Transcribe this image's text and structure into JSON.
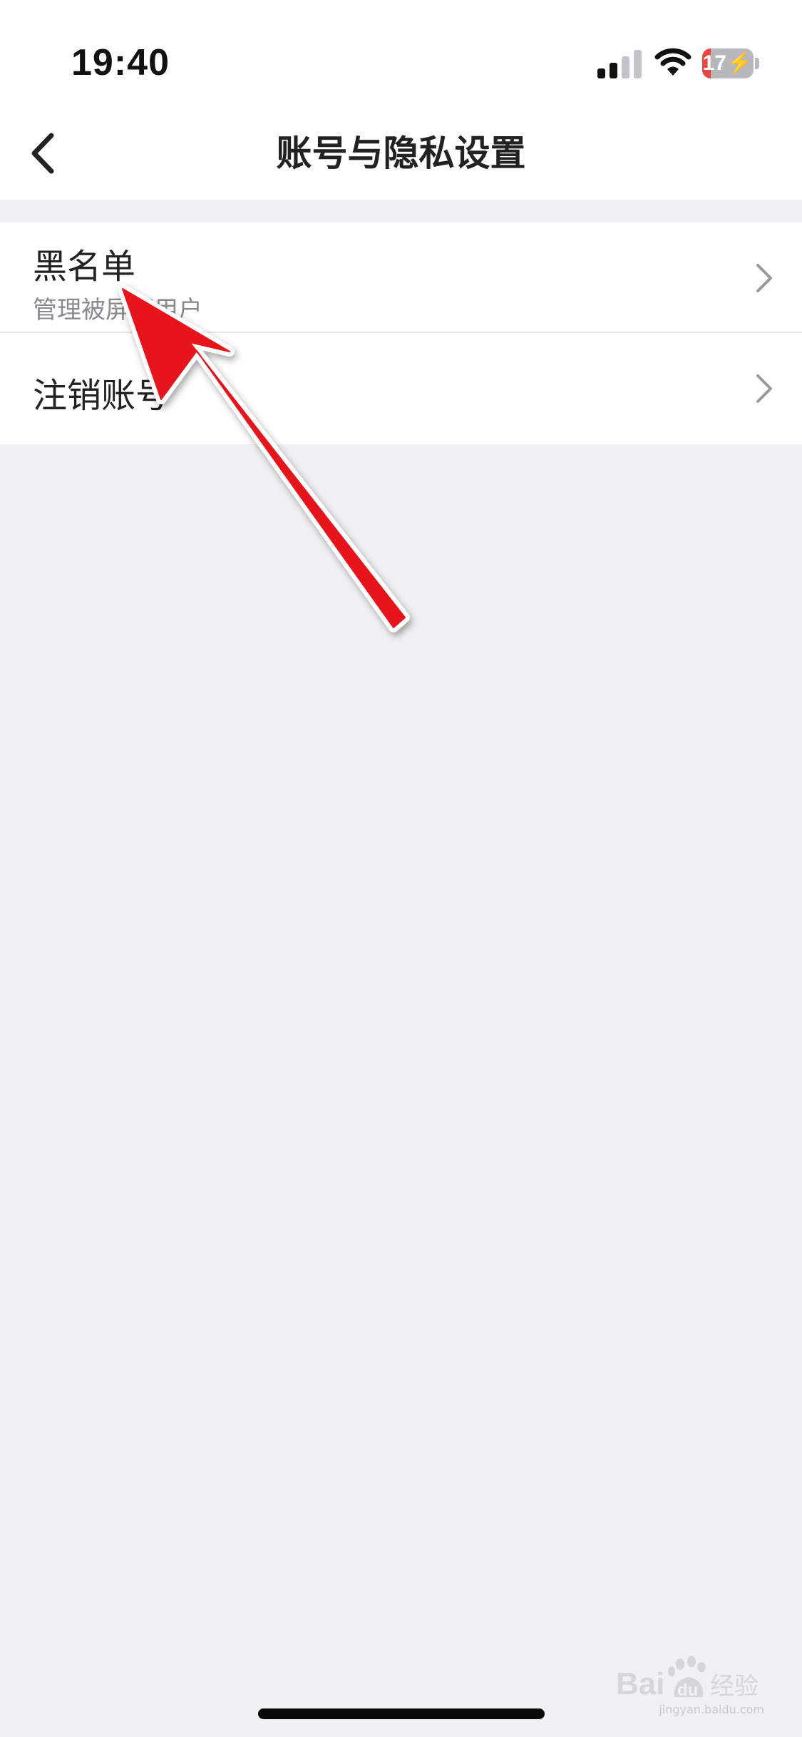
{
  "status_bar": {
    "time": "19:40",
    "battery_level": "17",
    "battery_fraction": 0.17,
    "signal_icon": "cellular-signal-icon",
    "wifi_icon": "wifi-icon",
    "battery_icon": "battery-charging-icon",
    "colors": {
      "battery_low": "#ec4540",
      "battery_empty": "#b8b8bc"
    }
  },
  "nav": {
    "title": "账号与隐私设置",
    "back_icon": "chevron-left-icon"
  },
  "settings": {
    "items": [
      {
        "title": "黑名单",
        "subtitle": "管理被屏蔽用户",
        "chevron_icon": "chevron-right-icon"
      },
      {
        "title": "注销账号",
        "chevron_icon": "chevron-right-icon"
      }
    ]
  },
  "annotation": {
    "icon": "red-arrow-annotation",
    "color": "#e8141b"
  },
  "watermark": {
    "text": "Bai du 经验",
    "url": "jingyan.baidu.com"
  }
}
